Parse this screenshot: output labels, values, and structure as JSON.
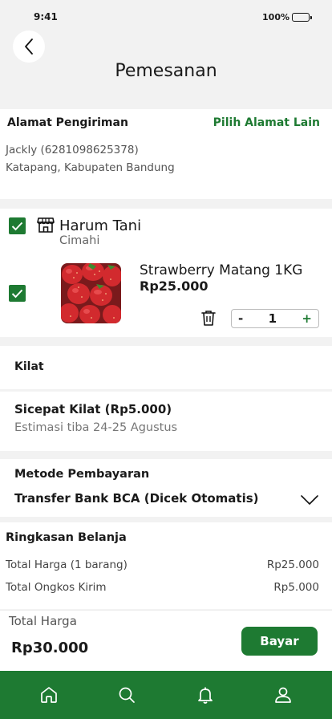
{
  "status_bar": {
    "time": "9:41",
    "battery": "100%"
  },
  "header": {
    "title": "Pemesanan"
  },
  "address": {
    "title": "Alamat Pengiriman",
    "change_label": "Pilih Alamat Lain",
    "recipient": "Jackly (6281098625378)",
    "location": "Katapang, Kabupaten Bandung"
  },
  "store": {
    "name": "Harum Tani",
    "city": "Cimahi",
    "product": {
      "name": "Strawberry Matang 1KG",
      "price": "Rp25.000",
      "quantity": "1",
      "minus": "-",
      "plus": "+"
    }
  },
  "shipping": {
    "type": "Kilat",
    "courier": "Sicepat Kilat (Rp5.000)",
    "eta": "Estimasi tiba 24-25 Agustus"
  },
  "payment": {
    "title": "Metode Pembayaran",
    "method": "Transfer Bank BCA (Dicek Otomatis)"
  },
  "summary": {
    "title": "Ringkasan Belanja",
    "rows": [
      {
        "label": "Total Harga (1 barang)",
        "value": "Rp25.000"
      },
      {
        "label": "Total Ongkos Kirim",
        "value": "Rp5.000"
      }
    ]
  },
  "footer": {
    "total_label": "Total Harga",
    "total_value": "Rp30.000",
    "pay_label": "Bayar"
  },
  "colors": {
    "accent": "#1e7a32",
    "background": "#f2f2f2"
  },
  "nav_icons": [
    "home-icon",
    "search-icon",
    "bell-icon",
    "user-icon"
  ]
}
